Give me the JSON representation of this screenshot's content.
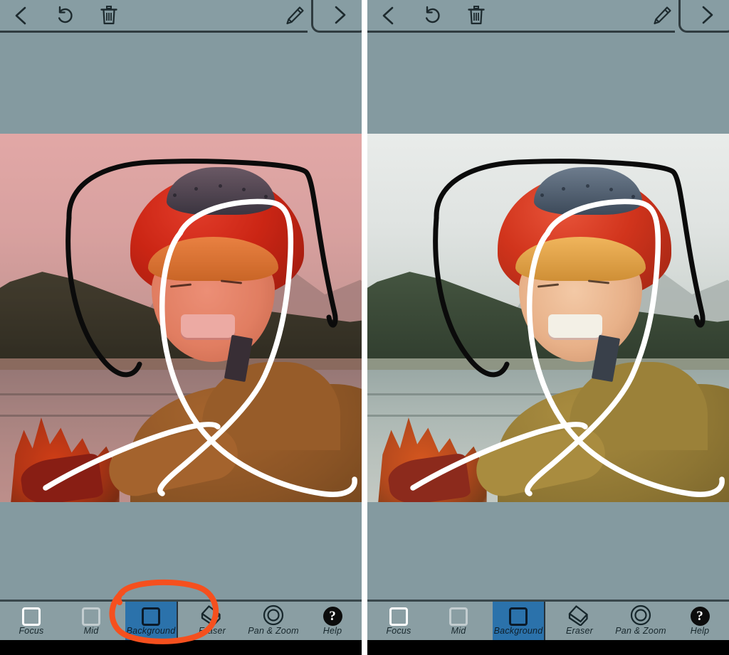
{
  "app": {
    "background_color": "#849aa0",
    "toolbar_color": "#8a9ea3",
    "accent_selected": "#2b72ab",
    "mask_color": "#f06a6a",
    "annotation_color": "#f5501e"
  },
  "panels": [
    {
      "id": "left",
      "mask_visible": true,
      "annotation_visible": true,
      "top_toolbar": {
        "back_label": "back-chevron",
        "undo_label": "undo",
        "delete_label": "delete",
        "edit_label": "edit",
        "next_label": "next-chevron"
      },
      "tools": [
        {
          "name": "focus",
          "label": "Focus",
          "icon": "empty-square",
          "selected": false
        },
        {
          "name": "mid",
          "label": "Mid",
          "icon": "empty-square",
          "selected": false
        },
        {
          "name": "background",
          "label": "Background",
          "icon": "filled-square",
          "selected": true
        },
        {
          "name": "eraser",
          "label": "Eraser",
          "icon": "eraser-icon",
          "selected": false
        },
        {
          "name": "pan-zoom",
          "label": "Pan & Zoom",
          "icon": "target-icon",
          "selected": false
        },
        {
          "name": "help",
          "label": "Help",
          "icon": "question-icon",
          "selected": false
        }
      ]
    },
    {
      "id": "right",
      "mask_visible": false,
      "annotation_visible": false,
      "top_toolbar": {
        "back_label": "back-chevron",
        "undo_label": "undo",
        "delete_label": "delete",
        "edit_label": "edit",
        "next_label": "next-chevron"
      },
      "tools": [
        {
          "name": "focus",
          "label": "Focus",
          "icon": "empty-square",
          "selected": false
        },
        {
          "name": "mid",
          "label": "Mid",
          "icon": "empty-square",
          "selected": false
        },
        {
          "name": "background",
          "label": "Background",
          "icon": "filled-square",
          "selected": true
        },
        {
          "name": "eraser",
          "label": "Eraser",
          "icon": "eraser-icon",
          "selected": false
        },
        {
          "name": "pan-zoom",
          "label": "Pan & Zoom",
          "icon": "target-icon",
          "selected": false
        },
        {
          "name": "help",
          "label": "Help",
          "icon": "question-icon",
          "selected": false
        }
      ]
    }
  ],
  "photo": {
    "description": "child in red cycling helmet smiling beside a lake with forested hills",
    "foreground_strokes_color": "#ffffff",
    "background_strokes_color": "#0b0b0b"
  }
}
